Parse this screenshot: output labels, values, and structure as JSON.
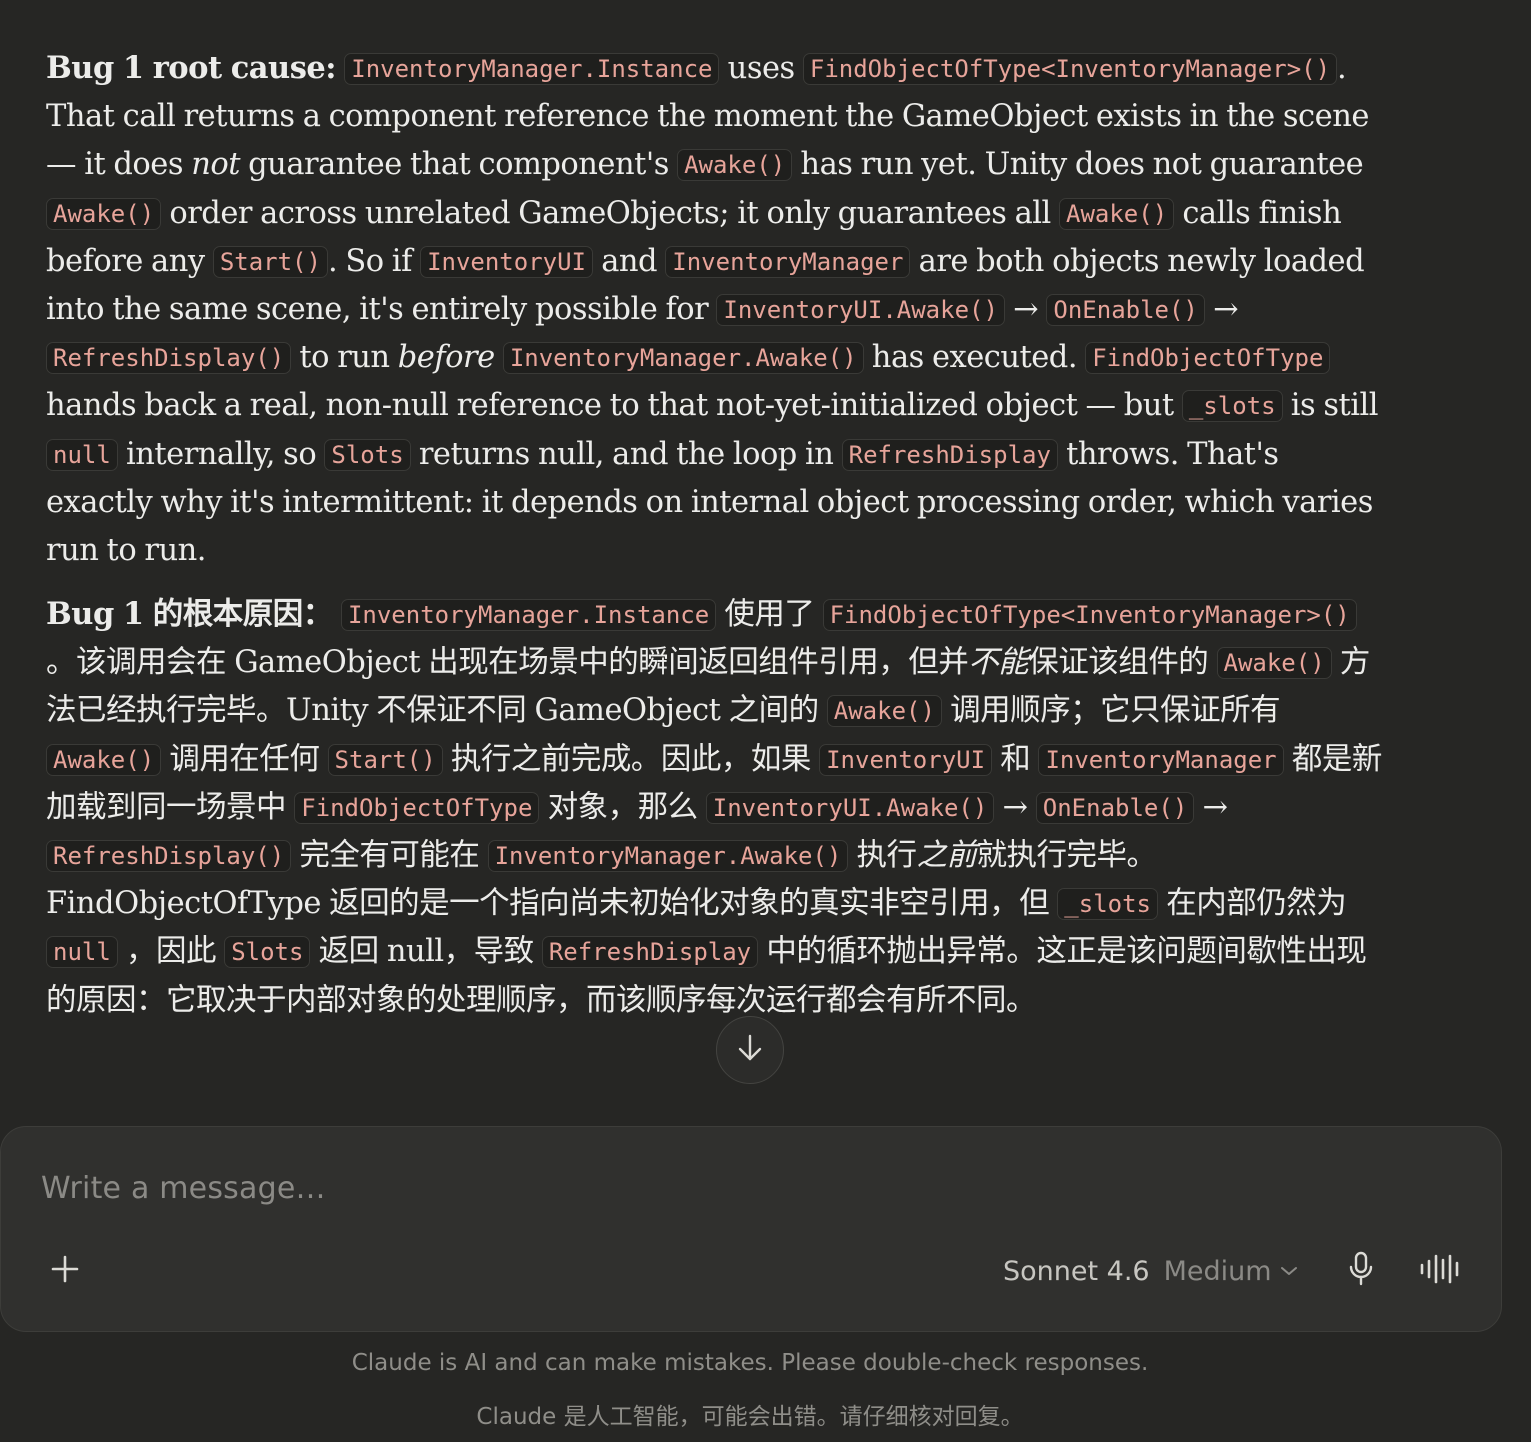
{
  "messages": {
    "en": {
      "lead": "Bug 1 root cause:",
      "c1": "InventoryManager.Instance",
      "t1": " uses ",
      "c2": "FindObjectOfType<InventoryManager>()",
      "t2": ". That call returns a component reference the moment the GameObject exists in the scene — it does ",
      "e1": "not",
      "t3": " guarantee that component's ",
      "c3": "Awake()",
      "t4": " has run yet. Unity does not guarantee ",
      "c4": "Awake()",
      "t5": " order across unrelated GameObjects; it only guarantees all ",
      "c5": "Awake()",
      "t6": " calls finish before any ",
      "c6": "Start()",
      "t7": ". So if ",
      "c7": "InventoryUI",
      "t8": " and ",
      "c8": "InventoryManager",
      "t9": " are both objects newly loaded into the same scene, it's entirely possible for ",
      "c9": "InventoryUI.Awake()",
      "t10": " → ",
      "c10": "OnEnable()",
      "t11": " → ",
      "c11": "RefreshDisplay()",
      "t12": " to run ",
      "e2": "before",
      "t13": " ",
      "c12": "InventoryManager.Awake()",
      "t14": " has executed. ",
      "c13": "FindObjectOfType",
      "t15": " hands back a real, non-null reference to that not-yet-initialized object — but ",
      "c14": "_slots",
      "t16": " is still ",
      "c15": "null",
      "t17": " internally, so ",
      "c16": "Slots",
      "t18": " returns null, and the loop in ",
      "c17": "RefreshDisplay",
      "t19": " throws. That's exactly why it's intermittent: it depends on internal object processing order, which varies run to run."
    },
    "zh": {
      "lead": "Bug 1 的根本原因：",
      "c1": "InventoryManager.Instance",
      "t1": " 使用了 ",
      "c2": "FindObjectOfType<InventoryManager>()",
      "t2": " 。该调用会在 GameObject 出现在场景中的瞬间返回组件引用，但并",
      "e1": "不能",
      "t3": "保证该组件的 ",
      "c3": "Awake()",
      "t4": " 方法已经执行完毕。Unity 不保证不同 GameObject 之间的 ",
      "c4": "Awake()",
      "t5": " 调用顺序；它只保证所有 ",
      "c5": "Awake()",
      "t6": " 调用在任何 ",
      "c6": "Start()",
      "t7": " 执行之前完成。因此，如果 ",
      "c7": "InventoryUI",
      "t8": " 和 ",
      "c8": "InventoryManager",
      "t9": " 都是新加载到同一场景中 ",
      "c9": "FindObjectOfType",
      "t10": " 对象，那么 ",
      "c10": "InventoryUI.Awake()",
      "t11": " → ",
      "c11": "OnEnable()",
      "t12": " → ",
      "c12": "RefreshDisplay()",
      "t13": " 完全有可能在 ",
      "c13": "InventoryManager.Awake()",
      "t14": " 执行",
      "e2": "之前",
      "t15": "就执行完毕。FindObjectOfType 返回的是一个指向尚未初始化对象的真实非空引用，但 ",
      "c14": "_slots",
      "t16": " 在内部仍然为 ",
      "c15": "null",
      "t17": " ，因此 ",
      "c16": "Slots",
      "t18": " 返回 null，导致 ",
      "c17": "RefreshDisplay",
      "t19": " 中的循环抛出异常。这正是该问题间歇性出现的原因：它取决于内部对象的处理顺序，而该顺序每次运行都会有所不同。"
    }
  },
  "composer": {
    "placeholder": "Write a message…",
    "model_name": "Sonnet 4.6",
    "model_effort": "Medium",
    "add_icon": "plus-icon",
    "mic_icon": "microphone-icon",
    "voice_icon": "voice-waveform-icon",
    "chevron_icon": "chevron-down-icon"
  },
  "scroll_button": {
    "icon": "arrow-down-icon"
  },
  "footer": {
    "disclaimer_en": "Claude is AI and can make mistakes. Please double-check responses.",
    "disclaimer_zh": "Claude 是人工智能，可能会出错。请仔细核对回复。"
  },
  "colors": {
    "background": "#262624",
    "text": "#ececea",
    "code_text": "#e7a49a",
    "code_bg": "#1f1f1d",
    "composer_bg": "#30302e",
    "muted": "#8b8a86"
  }
}
